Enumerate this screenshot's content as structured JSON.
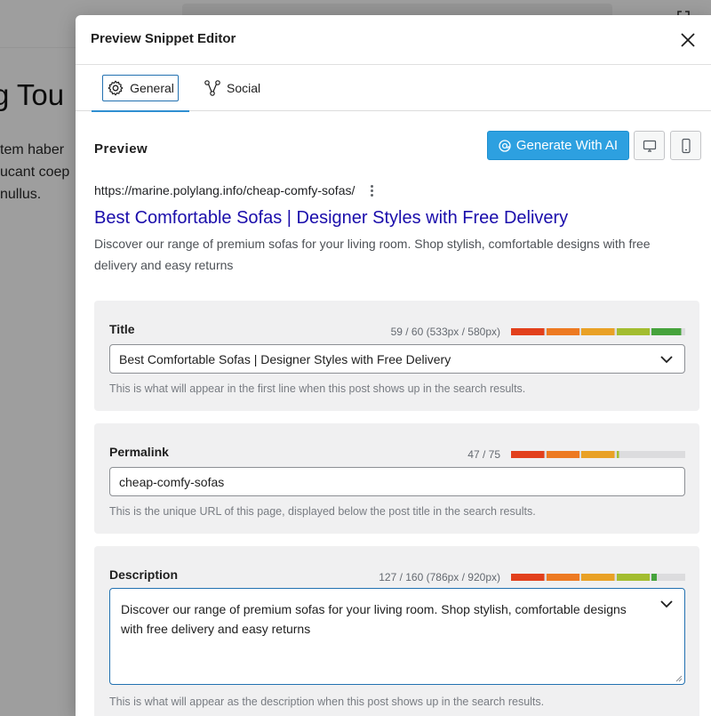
{
  "background": {
    "heading": "g Tou",
    "paragraph_lines": [
      "tem haber",
      "ucant coep",
      "nullus."
    ]
  },
  "modal": {
    "title": "Preview Snippet Editor",
    "tabs": [
      {
        "label": "General",
        "icon": "gear-icon",
        "active": true
      },
      {
        "label": "Social",
        "icon": "share-icon",
        "active": false
      }
    ],
    "preview": {
      "label": "Preview",
      "generate_button": "Generate With AI",
      "device_buttons": [
        "desktop-icon",
        "mobile-icon"
      ]
    },
    "snippet": {
      "url": "https://marine.polylang.info/cheap-comfy-sofas/",
      "title": "Best Comfortable Sofas | Designer Styles with Free Delivery",
      "description": "Discover our range of premium sofas for your living room. Shop stylish, comfortable designs with free delivery and easy returns"
    },
    "fields": {
      "title": {
        "label": "Title",
        "count": "59 / 60 (533px / 580px)",
        "value": "Best Comfortable Sofas | Designer Styles with Free Delivery",
        "help": "This is what will appear in the first line when this post shows up in the search results.",
        "meter_fill": 0.98
      },
      "permalink": {
        "label": "Permalink",
        "count": "47 / 75",
        "value": "cheap-comfy-sofas",
        "help": "This is the unique URL of this page, displayed below the post title in the search results.",
        "meter_fill": 0.62
      },
      "description": {
        "label": "Description",
        "count": "127 / 160 (786px / 920px)",
        "value": "Discover our range of premium sofas for your living room. Shop stylish, comfortable designs with free delivery and easy returns",
        "help": "This is what will appear as the description when this post shows up in the search results.",
        "meter_fill": 0.84
      }
    },
    "colors": {
      "accent": "#2da0e0",
      "link": "#1a0dab",
      "meter": [
        "#e2401c",
        "#ed7a22",
        "#e9a126",
        "#a3bd30",
        "#46a33c"
      ]
    }
  }
}
